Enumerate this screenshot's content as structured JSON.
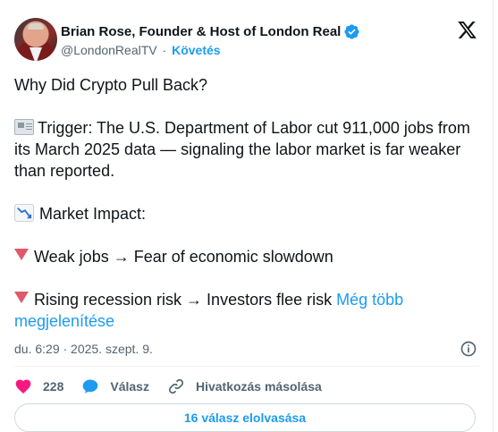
{
  "author": {
    "display_name": "Brian Rose, Founder & Host of London Real",
    "handle": "@LondonRealTV",
    "separator": "·",
    "follow_label": "Követés",
    "verified": true
  },
  "tweet": {
    "line_title": "Why Did Crypto Pull Back?",
    "trigger": "Trigger: The U.S. Department of Labor cut 911,000 jobs from its March 2025 data — signaling the labor market is far weaker than reported.",
    "impact_heading": "Market Impact:",
    "point_1": "Weak jobs → Fear of economic slowdown",
    "point_2": "Rising recession risk → Investors flee risk",
    "show_more": "Még több megjelenítése"
  },
  "meta": {
    "timestamp": "du. 6:29 · 2025. szept. 9."
  },
  "actions": {
    "like_count": "228",
    "reply_label": "Válasz",
    "copy_link_label": "Hivatkozás másolása"
  },
  "footer": {
    "read_replies_label": "16 válasz elolvasása"
  },
  "colors": {
    "accent": "#1d9bf0",
    "like": "#f91880",
    "text": "#0f1419",
    "muted": "#536471"
  }
}
